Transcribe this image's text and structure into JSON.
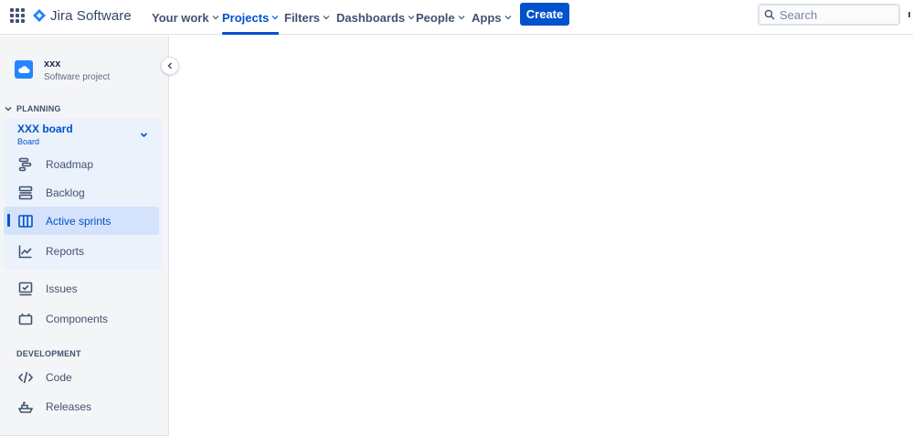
{
  "topbar": {
    "product_name": "Jira Software",
    "nav": [
      {
        "label": "Your work",
        "active": false
      },
      {
        "label": "Projects",
        "active": true
      },
      {
        "label": "Filters",
        "active": false
      },
      {
        "label": "Dashboards",
        "active": false
      },
      {
        "label": "People",
        "active": false
      },
      {
        "label": "Apps",
        "active": false
      }
    ],
    "create_label": "Create",
    "search_placeholder": "Search"
  },
  "sidebar": {
    "project": {
      "name": "xxx",
      "type": "Software project"
    },
    "planning_label": "PLANNING",
    "board": {
      "title": "XXX board",
      "subtitle": "Board"
    },
    "board_items": [
      {
        "label": "Roadmap",
        "icon": "roadmap-icon"
      },
      {
        "label": "Backlog",
        "icon": "backlog-icon"
      },
      {
        "label": "Active sprints",
        "icon": "board-columns-icon",
        "selected": true
      },
      {
        "label": "Reports",
        "icon": "reports-chart-icon"
      }
    ],
    "project_items": [
      {
        "label": "Issues",
        "icon": "issues-icon"
      },
      {
        "label": "Components",
        "icon": "components-icon"
      }
    ],
    "development_label": "DEVELOPMENT",
    "development_items": [
      {
        "label": "Code",
        "icon": "code-icon"
      },
      {
        "label": "Releases",
        "icon": "releases-ship-icon"
      }
    ]
  },
  "colors": {
    "accent": "#0052cc",
    "nav_text": "#42526e",
    "sidebar_bg": "#f4f5f7",
    "board_group_bg": "#ebf2fc",
    "selected_bg": "#d4e3fb"
  }
}
